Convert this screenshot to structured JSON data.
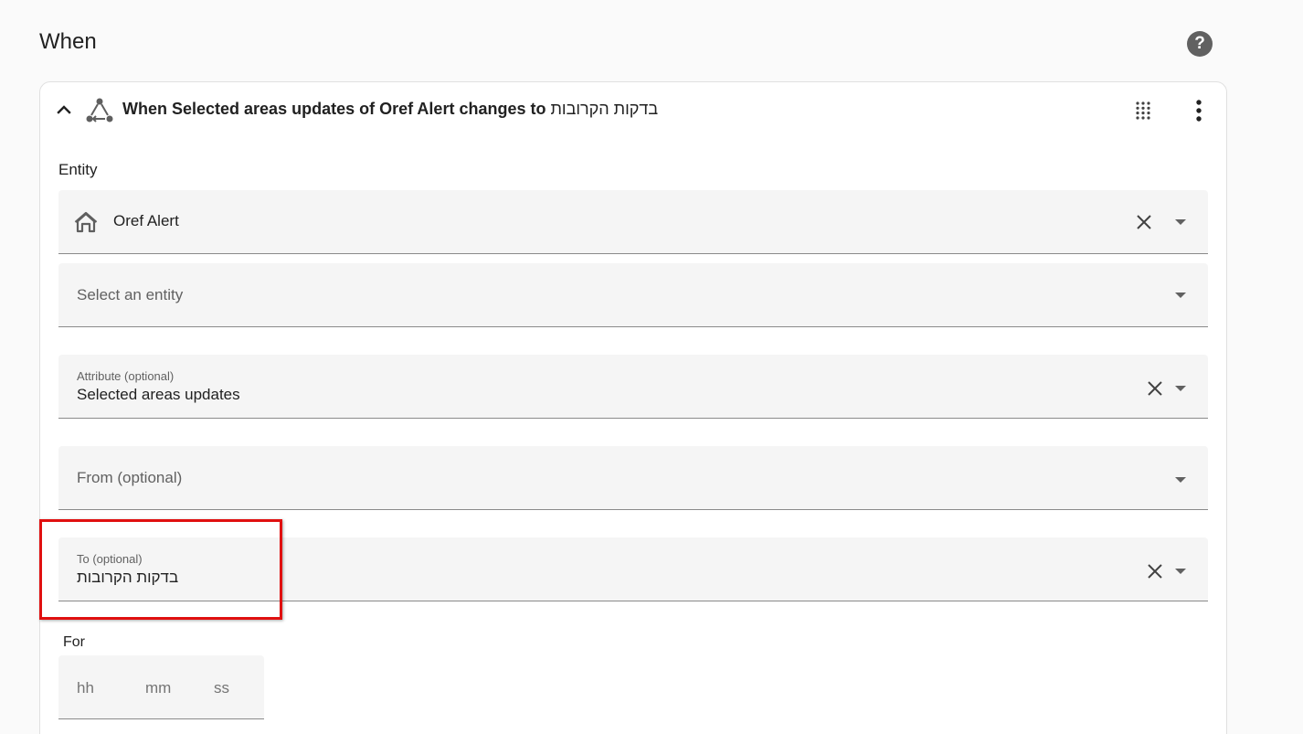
{
  "section": {
    "title": "When"
  },
  "trigger": {
    "title_prefix": "When Selected areas updates of Oref Alert changes to ",
    "title_rtl": "בדקות הקרובות"
  },
  "entity": {
    "label": "Entity",
    "selected": "Oref Alert",
    "add_placeholder": "Select an entity"
  },
  "attribute": {
    "label": "Attribute (optional)",
    "value": "Selected areas updates"
  },
  "from": {
    "placeholder": "From (optional)"
  },
  "to": {
    "label": "To (optional)",
    "value": "בדקות הקרובות"
  },
  "for": {
    "label": "For",
    "hours_placeholder": "hh",
    "minutes_placeholder": "mm",
    "seconds_placeholder": "ss"
  },
  "icons": {
    "help": "help-circle-icon",
    "collapse": "chevron-up-icon",
    "trigger": "state-trigger-icon",
    "drag": "drag-handle-icon",
    "more": "more-vertical-icon",
    "entity": "home-outline-icon",
    "clear": "close-icon",
    "dropdown": "menu-down-icon"
  },
  "colors": {
    "highlight": "#e01010",
    "field_bg": "#f5f5f5",
    "card_border": "#e0e0e0"
  }
}
